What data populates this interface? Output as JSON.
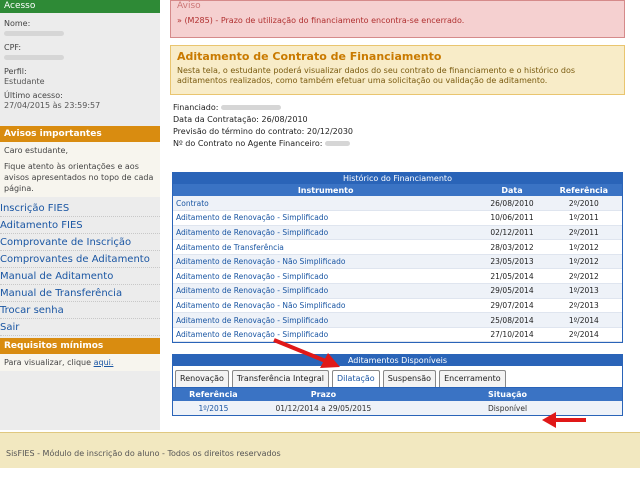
{
  "sidebar": {
    "access_title": "Acesso",
    "nome_label": "Nome:",
    "cpf_label": "CPF:",
    "perfil_label": "Perfil:",
    "perfil_value": "Estudante",
    "ultimo_label": "Último acesso:",
    "ultimo_value": "27/04/2015 às 23:59:57",
    "avisos_title": "Avisos importantes",
    "avisos_greeting": "Caro estudante,",
    "avisos_text": "Fique atento às orientações e aos avisos apresentados no topo de cada página.",
    "nav": [
      "Inscrição FIES",
      "Aditamento FIES",
      "Comprovante de Inscrição",
      "Comprovantes de Aditamento",
      "Manual de Aditamento",
      "Manual de Transferência",
      "Trocar senha",
      "Sair"
    ],
    "requisitos_title": "Requisitos mínimos",
    "requisitos_text": "Para visualizar, clique",
    "requisitos_link": "aqui."
  },
  "alert": {
    "title": "Aviso",
    "message": "» (M285) - Prazo de utilização do financiamento encontra-se encerrado."
  },
  "page": {
    "title": "Aditamento de Contrato de Financiamento",
    "description": "Nesta tela, o estudante poderá visualizar dados do seu contrato de financiamento e o histórico dos aditamentos realizados, como também efetuar uma solicitação ou validação de aditamento."
  },
  "details": {
    "financiado_label": "Financiado:",
    "data_contratacao": "Data da Contratação: 26/08/2010",
    "previsao": "Previsão do término do contrato: 20/12/2030",
    "contrato_label": "Nº do Contrato no Agente Financeiro:"
  },
  "historico": {
    "title": "Histórico do Financiamento",
    "headers": [
      "Instrumento",
      "Data",
      "Referência"
    ],
    "rows": [
      {
        "instrumento": "Contrato",
        "data": "26/08/2010",
        "ref": "2º/2010"
      },
      {
        "instrumento": "Aditamento de Renovação - Simplificado",
        "data": "10/06/2011",
        "ref": "1º/2011"
      },
      {
        "instrumento": "Aditamento de Renovação - Simplificado",
        "data": "02/12/2011",
        "ref": "2º/2011"
      },
      {
        "instrumento": "Aditamento de Transferência",
        "data": "28/03/2012",
        "ref": "1º/2012"
      },
      {
        "instrumento": "Aditamento de Renovação - Não Simplificado",
        "data": "23/05/2013",
        "ref": "1º/2012"
      },
      {
        "instrumento": "Aditamento de Renovação - Simplificado",
        "data": "21/05/2014",
        "ref": "2º/2012"
      },
      {
        "instrumento": "Aditamento de Renovação - Simplificado",
        "data": "29/05/2014",
        "ref": "1º/2013"
      },
      {
        "instrumento": "Aditamento de Renovação - Não Simplificado",
        "data": "29/07/2014",
        "ref": "2º/2013"
      },
      {
        "instrumento": "Aditamento de Renovação - Simplificado",
        "data": "25/08/2014",
        "ref": "1º/2014"
      },
      {
        "instrumento": "Aditamento de Renovação - Simplificado",
        "data": "27/10/2014",
        "ref": "2º/2014"
      }
    ]
  },
  "disponiveis": {
    "title": "Aditamentos Disponíveis",
    "tabs": [
      "Renovação",
      "Transferência Integral",
      "Dilatação",
      "Suspensão",
      "Encerramento"
    ],
    "active_tab": "Dilatação",
    "headers": [
      "Referência",
      "Prazo",
      "Situação"
    ],
    "row": {
      "ref": "1º/2015",
      "prazo": "01/12/2014 a 29/05/2015",
      "situacao": "Disponível"
    }
  },
  "footer": {
    "text": "SisFIES - Módulo de inscrição do aluno - Todos os direitos reservados"
  },
  "colors": {
    "arrow": "#e01818",
    "link": "#1a56a3",
    "table_header": "#2a64b8",
    "orange": "#d98c10"
  }
}
